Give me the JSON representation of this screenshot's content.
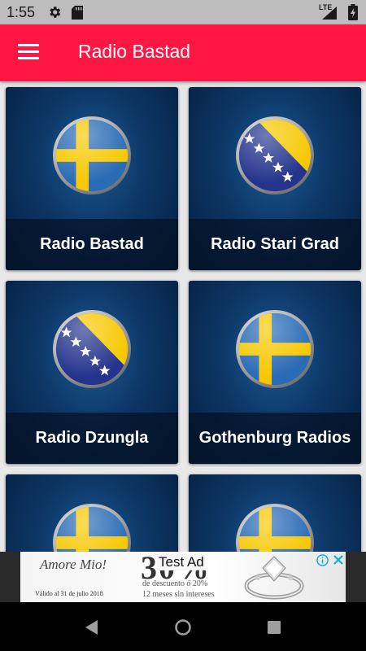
{
  "status_bar": {
    "time": "1:55",
    "network": "LTE",
    "icons": [
      "gear-icon",
      "sd-card-icon",
      "signal-icon",
      "battery-icon"
    ]
  },
  "app_bar": {
    "title": "Radio Bastad",
    "menu_icon": "hamburger-menu-icon",
    "color": "#ff1744"
  },
  "cards": [
    {
      "label": "Radio Bastad",
      "flag": "sweden"
    },
    {
      "label": "Radio Stari Grad",
      "flag": "bosnia"
    },
    {
      "label": "Radio Dzungla",
      "flag": "bosnia"
    },
    {
      "label": "Gothenburg Radios",
      "flag": "sweden"
    },
    {
      "label": "",
      "flag": "sweden"
    },
    {
      "label": "",
      "flag": "sweden"
    }
  ],
  "ad": {
    "badge": "Test Ad",
    "brand": "Amore Mio!",
    "validity": "Válido al 31 de julio 2018",
    "headline": "30%",
    "line1": "de descuento ó 20%",
    "line2": "12 meses sin intereses"
  },
  "nav_bar": {
    "icons": [
      "back-icon",
      "home-icon",
      "recents-icon"
    ]
  }
}
